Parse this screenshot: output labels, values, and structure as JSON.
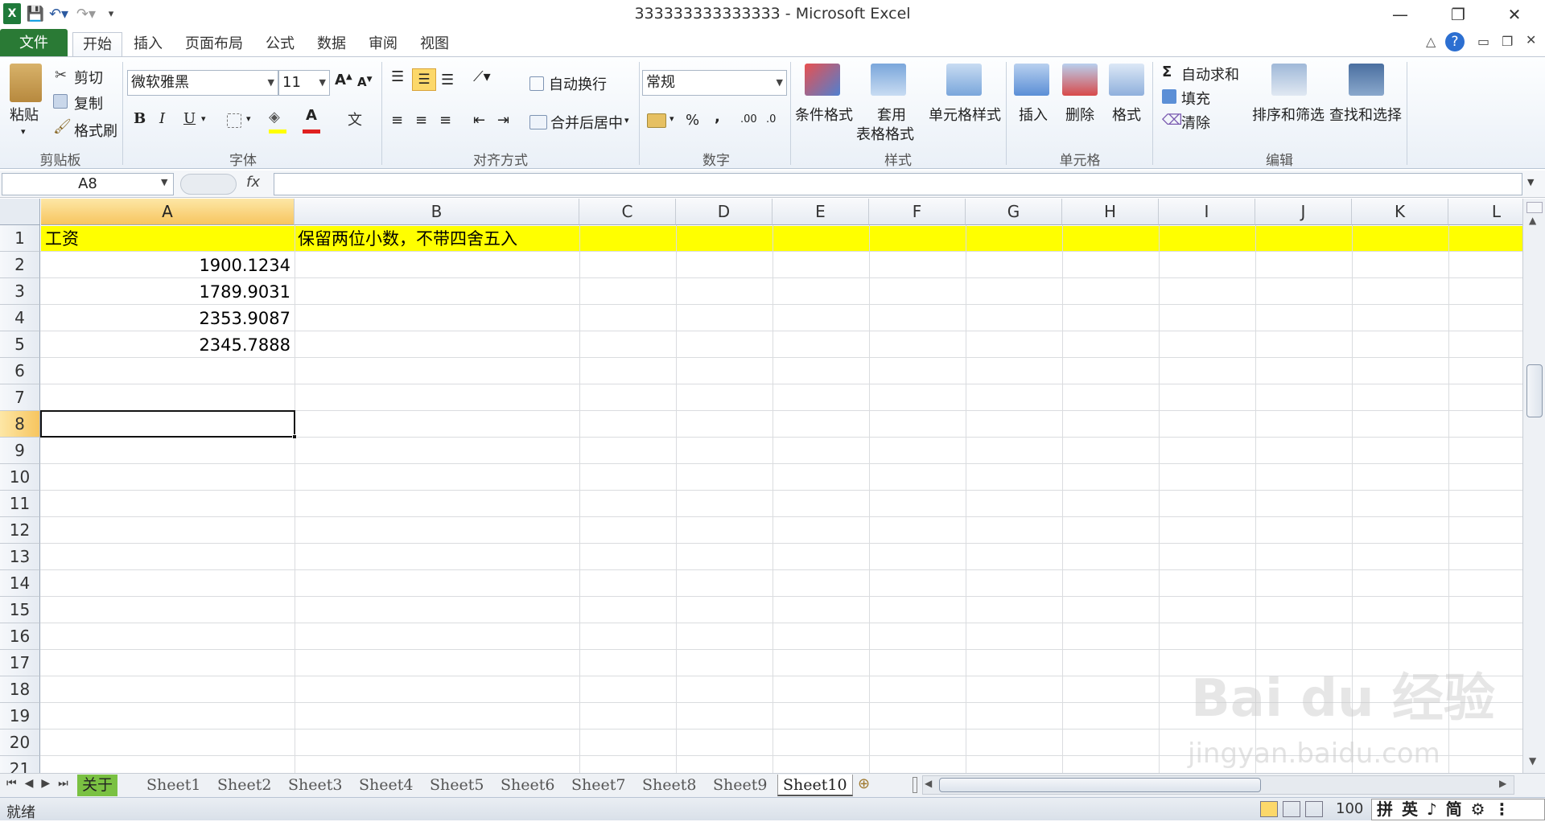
{
  "window": {
    "title": "333333333333333 - Microsoft Excel",
    "controls": {
      "minimize": "—",
      "restore": "❐",
      "close": "✕"
    }
  },
  "quick_access": {
    "save_icon": "save-icon",
    "undo_icon": "undo-icon",
    "redo_icon": "redo-icon"
  },
  "ribbon_tabs": [
    "文件",
    "开始",
    "插入",
    "页面布局",
    "公式",
    "数据",
    "审阅",
    "视图"
  ],
  "ribbon": {
    "clipboard": {
      "paste": "粘贴",
      "cut": "剪切",
      "copy": "复制",
      "format_painter": "格式刷",
      "group": "剪贴板"
    },
    "font": {
      "name": "微软雅黑",
      "size": "11",
      "bold": "B",
      "italic": "I",
      "underline": "U",
      "group": "字体"
    },
    "alignment": {
      "wrap": "自动换行",
      "merge": "合并后居中",
      "group": "对齐方式"
    },
    "number": {
      "format": "常规",
      "percent": "%",
      "comma": ",",
      "group": "数字"
    },
    "styles": {
      "conditional": "条件格式",
      "table_1": "套用",
      "table_2": "表格格式",
      "cell_styles": "单元格样式",
      "group": "样式"
    },
    "cells": {
      "insert": "插入",
      "delete": "删除",
      "format": "格式",
      "group": "单元格"
    },
    "editing": {
      "autosum": "自动求和",
      "fill": "填充",
      "clear": "清除",
      "sort": "排序和筛选",
      "find": "查找和选择",
      "group": "编辑"
    }
  },
  "formula_bar": {
    "name_box": "A8",
    "fx": "fx",
    "value": ""
  },
  "columns": [
    "A",
    "B",
    "C",
    "D",
    "E",
    "F",
    "G",
    "H",
    "I",
    "J",
    "K",
    "L"
  ],
  "rows": [
    "1",
    "2",
    "3",
    "4",
    "5",
    "6",
    "7",
    "8",
    "9",
    "10",
    "11",
    "12",
    "13",
    "14",
    "15",
    "16",
    "17",
    "18",
    "19",
    "20",
    "21"
  ],
  "cells": {
    "A1": "工资",
    "B1": "保留两位小数，不带四舍五入",
    "A2": "1900.1234",
    "A3": "1789.9031",
    "A4": "2353.9087",
    "A5": "2345.7888"
  },
  "header_fill": "#ffff00",
  "selected_cell": "A8",
  "sheet_tabs": [
    "关于",
    "Sheet1",
    "Sheet2",
    "Sheet3",
    "Sheet4",
    "Sheet5",
    "Sheet6",
    "Sheet7",
    "Sheet8",
    "Sheet9",
    "Sheet10"
  ],
  "active_sheet": "Sheet10",
  "status": {
    "ready": "就绪",
    "zoom": "100",
    "ime": "拼 英 ♪ 简 ⚙ ⋮"
  },
  "watermark": {
    "brand": "Bai du 经验",
    "url": "jingyan.baidu.com"
  }
}
